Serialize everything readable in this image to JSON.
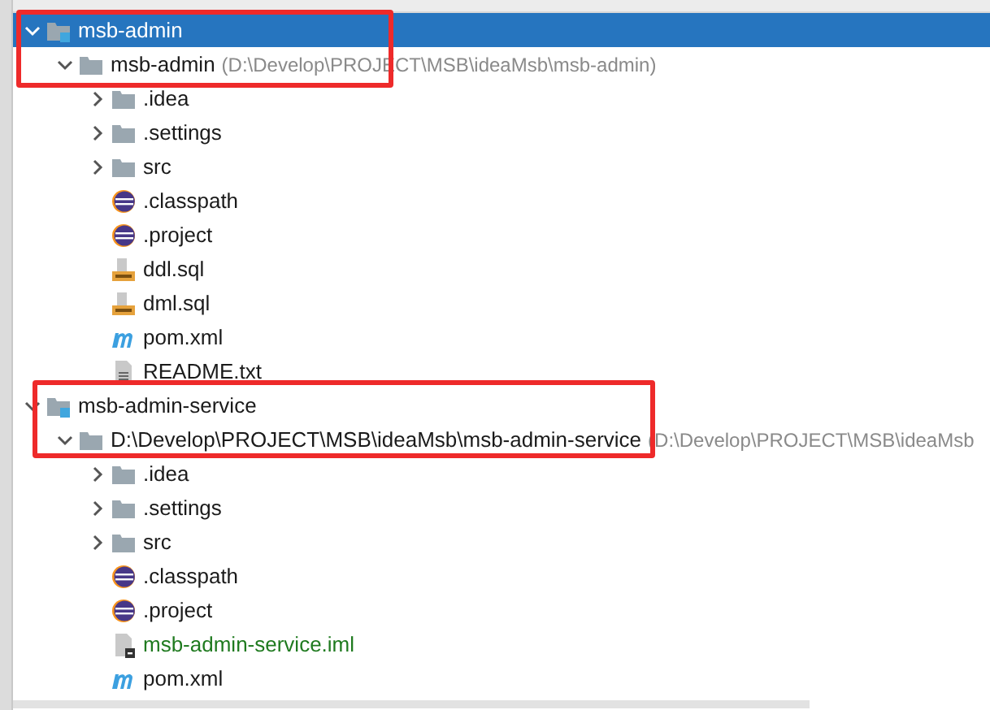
{
  "tree": [
    {
      "label": "msb-admin",
      "kind": "module",
      "expanded": true,
      "selected": true,
      "annotated": true,
      "children": [
        {
          "label": "msb-admin",
          "detail": "(D:\\Develop\\PROJECT\\MSB\\ideaMsb\\msb-admin)",
          "kind": "folder",
          "expanded": true,
          "selected": false,
          "children": [
            {
              "label": ".idea",
              "kind": "folder",
              "expanded": false,
              "selected": false
            },
            {
              "label": ".settings",
              "kind": "folder",
              "expanded": false,
              "selected": false
            },
            {
              "label": "src",
              "kind": "folder",
              "expanded": false,
              "selected": false
            },
            {
              "label": ".classpath",
              "kind": "eclipse",
              "selected": false
            },
            {
              "label": ".project",
              "kind": "eclipse",
              "selected": false
            },
            {
              "label": "ddl.sql",
              "kind": "sql",
              "selected": false
            },
            {
              "label": "dml.sql",
              "kind": "sql",
              "selected": false
            },
            {
              "label": "pom.xml",
              "kind": "maven",
              "selected": false
            },
            {
              "label": "README.txt",
              "kind": "text",
              "selected": false
            }
          ]
        }
      ]
    },
    {
      "label": "msb-admin-service",
      "kind": "module",
      "expanded": true,
      "selected": false,
      "annotated": true,
      "children": [
        {
          "label": "D:\\Develop\\PROJECT\\MSB\\ideaMsb\\msb-admin-service",
          "detail": "(D:\\Develop\\PROJECT\\MSB\\ideaMsb",
          "kind": "folder",
          "expanded": true,
          "selected": false,
          "children": [
            {
              "label": ".idea",
              "kind": "folder",
              "expanded": false,
              "selected": false
            },
            {
              "label": ".settings",
              "kind": "folder",
              "expanded": false,
              "selected": false
            },
            {
              "label": "src",
              "kind": "folder",
              "expanded": false,
              "selected": false
            },
            {
              "label": ".classpath",
              "kind": "eclipse",
              "selected": false
            },
            {
              "label": ".project",
              "kind": "eclipse",
              "selected": false
            },
            {
              "label": "msb-admin-service.iml",
              "kind": "iml",
              "selected": false
            },
            {
              "label": "pom.xml",
              "kind": "maven",
              "selected": false
            }
          ]
        }
      ]
    }
  ]
}
